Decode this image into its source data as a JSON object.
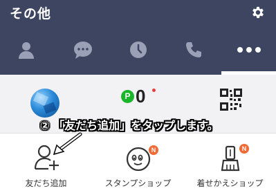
{
  "header": {
    "title": "その他"
  },
  "tabs": [
    {
      "icon": "person-icon"
    },
    {
      "icon": "chat-icon"
    },
    {
      "icon": "clock-icon"
    },
    {
      "icon": "phone-icon"
    },
    {
      "icon": "more-icon",
      "active": true
    }
  ],
  "profile": {
    "points_badge": "P",
    "points_value": "0"
  },
  "annotation": {
    "text": "② 「友だち追加」をタップします。"
  },
  "menu": [
    {
      "label": "友だち追加",
      "icon": "add-friend-icon"
    },
    {
      "label": "スタンプショップ",
      "icon": "sticker-shop-icon",
      "badge": "N"
    },
    {
      "label": "着せかえショップ",
      "icon": "theme-shop-icon",
      "badge": "N"
    }
  ],
  "colors": {
    "header_bg": "#3e4561",
    "points_green": "#1bb52b",
    "badge_orange": "#f06a35"
  }
}
